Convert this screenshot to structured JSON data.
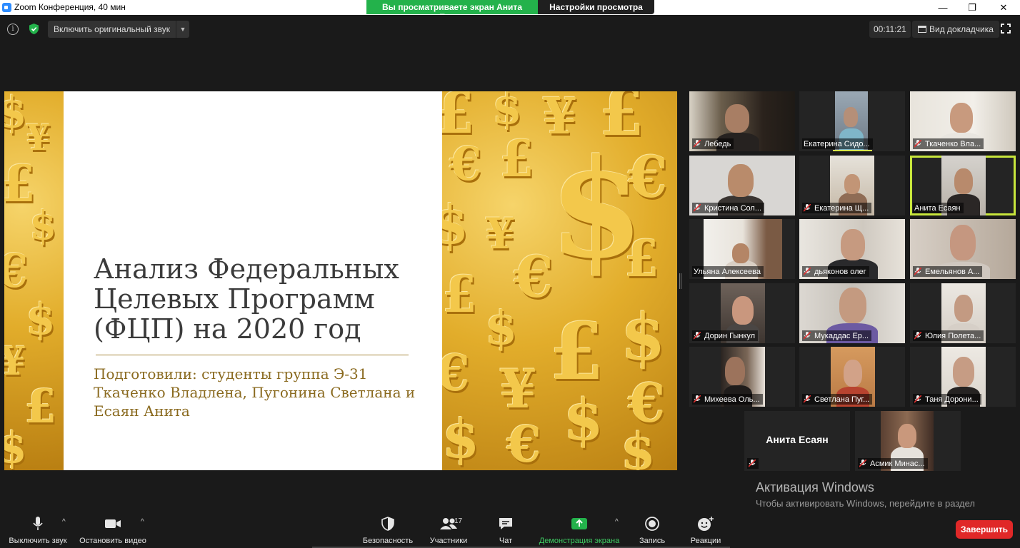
{
  "window": {
    "title": "Zoom Конференция, 40 мин",
    "minimize": "—",
    "maximize": "❐",
    "close": "✕"
  },
  "share_banner": {
    "viewing": "Вы просматриваете экран Анита Есаян",
    "view_settings": "Настройки просмотра ⌄"
  },
  "topbar": {
    "original_sound": "Включить оригинальный звук",
    "timer": "00:11:21",
    "speaker_view": "Вид докладчика"
  },
  "slide": {
    "title": "Анализ Федеральных Целевых Программ (ФЦП) на 2020 год",
    "subtitle": "Подготовили: студенты группа Э-31 Ткаченко Владлена, Пугонина Светлана и Есаян Анита"
  },
  "participants": [
    {
      "name": "Лебедь"
    },
    {
      "name": "Екатерина Сидо..."
    },
    {
      "name": "Ткаченко Вла..."
    },
    {
      "name": "Кристина Сол..."
    },
    {
      "name": "Екатерина Щ..."
    },
    {
      "name": "Анита Есаян"
    },
    {
      "name": "Ульяна Алексеева"
    },
    {
      "name": "дьяконов олег"
    },
    {
      "name": "Емельянов А..."
    },
    {
      "name": "Дорин Гынкул"
    },
    {
      "name": "Мукаддас Ер..."
    },
    {
      "name": "Юлия Полета..."
    },
    {
      "name": "Михеева Оль..."
    },
    {
      "name": "Светлана Пуг..."
    },
    {
      "name": "Таня Дорони..."
    },
    {
      "name": "Анита Есаян"
    },
    {
      "name": "Асмик Минас..."
    }
  ],
  "watermark": {
    "title": "Активация Windows",
    "text": "Чтобы активировать Windows, перейдите в раздел \"Параметры\"."
  },
  "toolbar": {
    "mute": "Выключить звук",
    "stop_video": "Остановить видео",
    "security": "Безопасность",
    "participants": "Участники",
    "participants_count": "17",
    "chat": "Чат",
    "share_screen": "Демонстрация экрана",
    "record": "Запись",
    "reactions": "Реакции",
    "end": "Завершить"
  },
  "colors": {
    "share_green": "#23b24b",
    "active_speaker": "#c8e63c",
    "end_red": "#e02828",
    "muted_red": "#e02f2f"
  }
}
